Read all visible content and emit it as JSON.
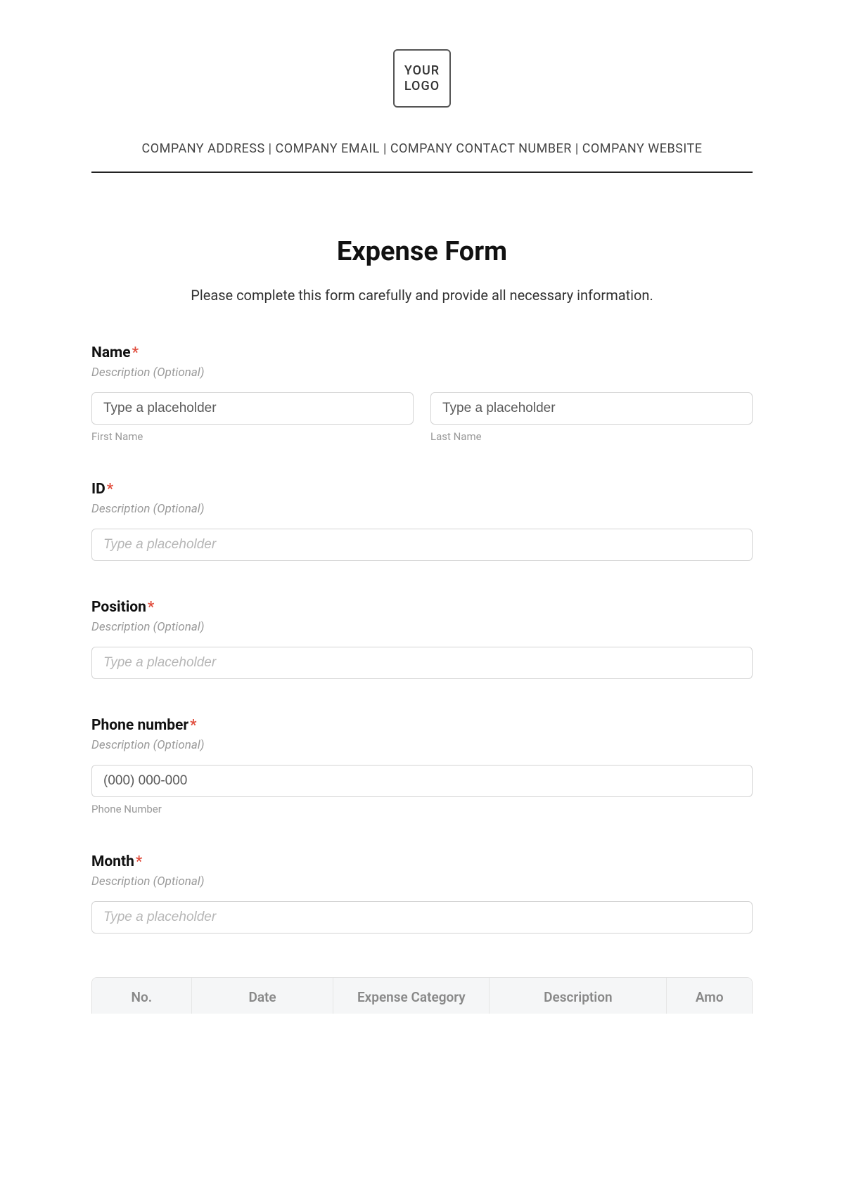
{
  "header": {
    "logo_line1": "YOUR",
    "logo_line2": "LOGO",
    "company_address": "COMPANY ADDRESS",
    "company_email": "COMPANY EMAIL",
    "company_contact": "COMPANY CONTACT NUMBER",
    "company_website": "COMPANY WEBSITE",
    "separator": " | "
  },
  "form": {
    "title": "Expense Form",
    "subtitle": "Please complete this form carefully and provide all necessary information.",
    "required_marker": "*",
    "description_optional": "Description (Optional)",
    "fields": {
      "name": {
        "label": "Name",
        "first_placeholder": "Type a placeholder",
        "first_sublabel": "First Name",
        "last_placeholder": "Type a placeholder",
        "last_sublabel": "Last Name"
      },
      "id": {
        "label": "ID",
        "placeholder": "Type a placeholder"
      },
      "position": {
        "label": "Position",
        "placeholder": "Type a placeholder"
      },
      "phone": {
        "label": "Phone number",
        "placeholder": "(000) 000-000",
        "sublabel": "Phone Number"
      },
      "month": {
        "label": "Month",
        "placeholder": "Type a placeholder"
      }
    },
    "table": {
      "headers": {
        "no": "No.",
        "date": "Date",
        "category": "Expense Category",
        "description": "Description",
        "amount": "Amo"
      }
    }
  }
}
